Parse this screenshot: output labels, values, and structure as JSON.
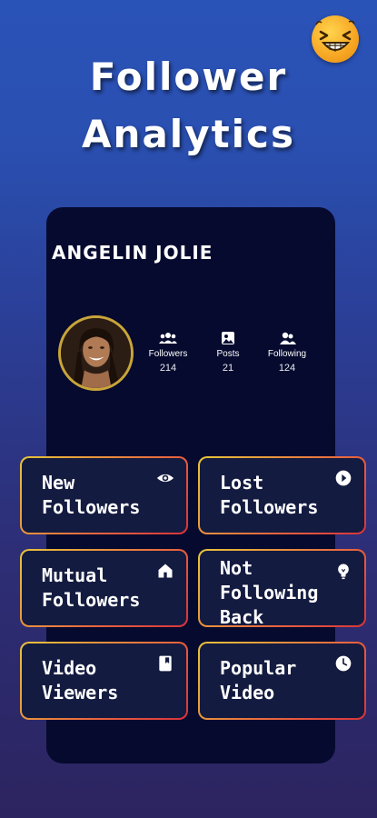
{
  "header": {
    "title_line1": "Follower",
    "title_line2": "Analytics",
    "logo_icon": "laughing-emoji-icon"
  },
  "profile": {
    "username": "ANGELIN JOLIE",
    "avatar_icon": "profile-photo",
    "stats": [
      {
        "icon": "people-icon",
        "label": "Followers",
        "value": "214"
      },
      {
        "icon": "photo-icon",
        "label": "Posts",
        "value": "21"
      },
      {
        "icon": "user-group-icon",
        "label": "Following",
        "value": "124"
      }
    ]
  },
  "tiles": [
    {
      "label": "New\nFollowers",
      "icon": "eye-icon"
    },
    {
      "label": "Lost\nFollowers",
      "icon": "play-circle-icon"
    },
    {
      "label": "Mutual\nFollowers",
      "icon": "home-icon"
    },
    {
      "label": "Not\nFollowing\nBack",
      "icon": "lightbulb-icon"
    },
    {
      "label": "Video\nViewers",
      "icon": "bookmark-icon"
    },
    {
      "label": "Popular\nVideo",
      "icon": "clock-icon"
    }
  ],
  "colors": {
    "panel": "#050a2e",
    "tile_border_start": "#e8c53a",
    "tile_border_end": "#d8333b",
    "background_top": "#2a53b8",
    "background_bottom": "#2c2460"
  }
}
